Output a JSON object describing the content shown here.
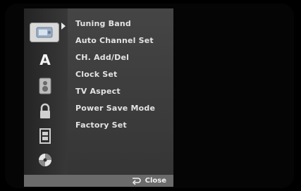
{
  "menu": {
    "items": [
      {
        "label": "Tuning Band"
      },
      {
        "label": "Auto Channel Set"
      },
      {
        "label": "CH. Add/Del"
      },
      {
        "label": "Clock Set"
      },
      {
        "label": "TV Aspect"
      },
      {
        "label": "Power Save Mode"
      },
      {
        "label": "Factory Set"
      }
    ]
  },
  "icons": {
    "setup": "setup-icon",
    "language": "language-icon",
    "audio": "audio-icon",
    "lock": "lock-icon",
    "recording": "film-icon",
    "disc": "disc-icon",
    "selected_letter": "A"
  },
  "footer": {
    "close_label": "Close"
  },
  "colors": {
    "panel": "#3f3f3f",
    "footer": "#6b6b6b",
    "text": "#e4e4e4",
    "selected": "#d9d9d9"
  }
}
